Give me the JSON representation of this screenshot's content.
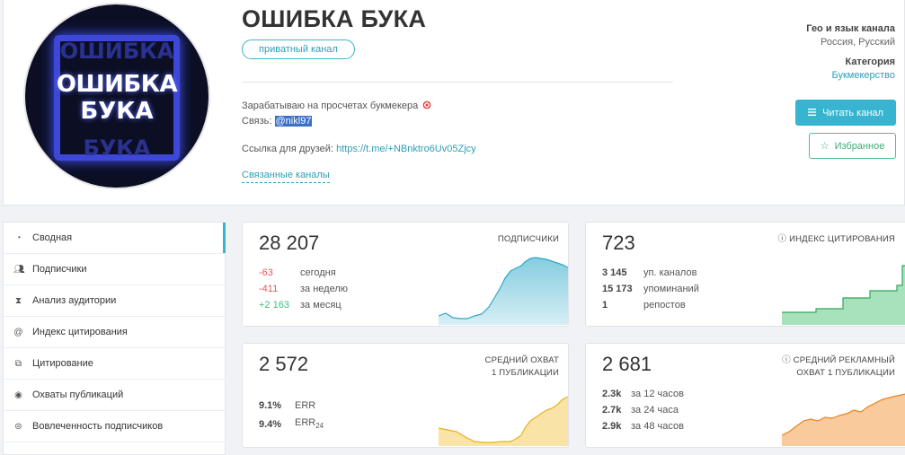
{
  "channel": {
    "title": "ОШИБКА БУКА",
    "badge": "приватный канал",
    "desc_line1": "Зарабатываю на просчетах букмекера",
    "desc_contact_label": "Связь:",
    "desc_contact_handle": "@nikl97",
    "friends_label": "Ссылка для друзей:",
    "friends_link": "https://t.me/+NBnktro6Uv05Zjcy",
    "related": "Связанные каналы",
    "avatar_text_line1": "ОШИБКА",
    "avatar_text_line2": "БУКА"
  },
  "meta": {
    "geo_label": "Гео и язык канала",
    "geo_value": "Россия, Русский",
    "category_label": "Категория",
    "category_value": "Букмекерство"
  },
  "buttons": {
    "read": "Читать канал",
    "favorite": "Избранное"
  },
  "sidebar": {
    "items": [
      {
        "label": "Сводная",
        "icon": "dashboard-icon"
      },
      {
        "label": "Подписчики",
        "icon": "users-icon"
      },
      {
        "label": "Анализ аудитории",
        "icon": "hourglass-icon"
      },
      {
        "label": "Индекс цитирования",
        "icon": "at-icon"
      },
      {
        "label": "Цитирование",
        "icon": "quote-icon"
      },
      {
        "label": "Охваты публикаций",
        "icon": "eye-icon"
      },
      {
        "label": "Вовлеченность подписчиков",
        "icon": "engagement-icon"
      }
    ]
  },
  "cards": {
    "subscribers": {
      "value": "28 207",
      "label": "ПОДПИСЧИКИ",
      "rows": [
        {
          "v": "-63",
          "l": "сегодня"
        },
        {
          "v": "-411",
          "l": "за неделю"
        },
        {
          "v": "+2 163",
          "l": "за месяц"
        }
      ],
      "color": "#5bbcd6"
    },
    "citation": {
      "value": "723",
      "label": "ИНДЕКС ЦИТИРОВАНИЯ",
      "rows": [
        {
          "v": "3 145",
          "l": "уп. каналов"
        },
        {
          "v": "15 173",
          "l": "упоминаний"
        },
        {
          "v": "1",
          "l": "репостов"
        }
      ],
      "color": "#3dbf6a"
    },
    "reach": {
      "value": "2 572",
      "label1": "СРЕДНИЙ ОХВАТ",
      "label2": "1 ПУБЛИКАЦИИ",
      "err_value": "9.1%",
      "err_label": "ERR",
      "err24_value": "9.4%",
      "err24_label": "ERR",
      "err24_sub": "24",
      "color": "#f2c23a"
    },
    "ad_reach": {
      "value": "2 681",
      "label1": "СРЕДНИЙ РЕКЛАМНЫЙ",
      "label2": "ОХВАТ 1 ПУБЛИКАЦИИ",
      "rows": [
        {
          "v": "2.3k",
          "l": "за 12 часов"
        },
        {
          "v": "2.7k",
          "l": "за 24 часа"
        },
        {
          "v": "2.9k",
          "l": "за 48 часов"
        }
      ],
      "color": "#f2963a"
    }
  }
}
